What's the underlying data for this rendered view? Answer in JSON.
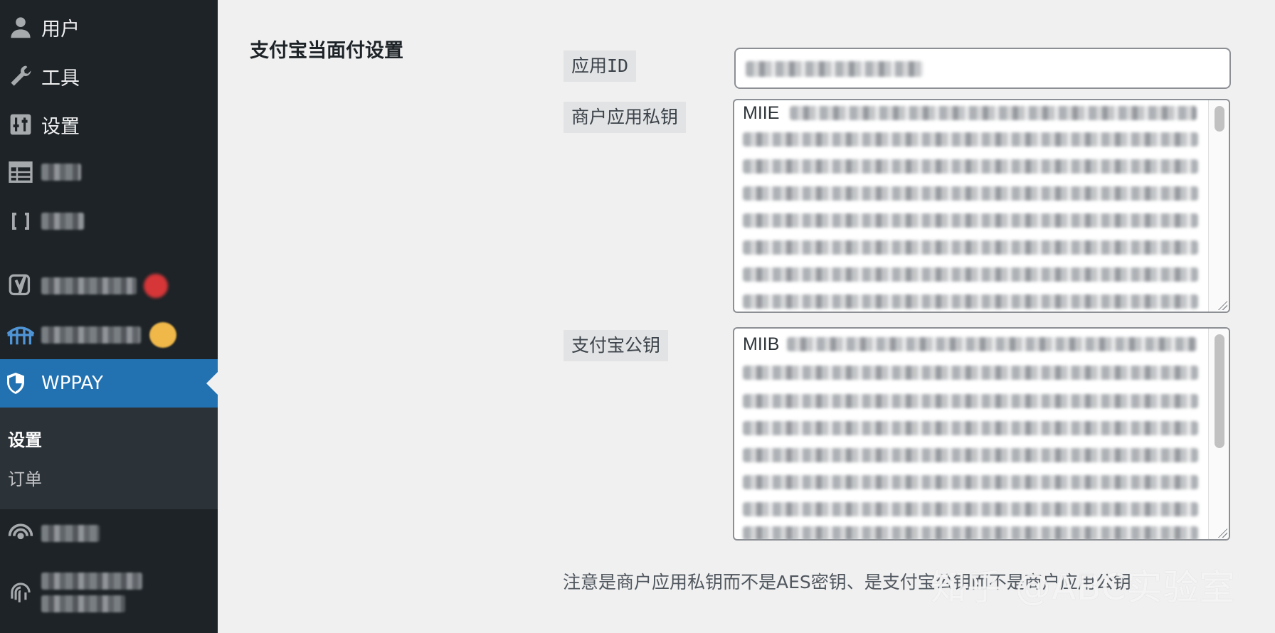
{
  "sidebar": {
    "items": [
      {
        "label": "用户",
        "icon": "user-icon"
      },
      {
        "label": "工具",
        "icon": "wrench-icon"
      },
      {
        "label": "设置",
        "icon": "settings-sliders-icon"
      },
      {
        "label": "",
        "icon": "table-icon"
      },
      {
        "label": "",
        "icon": "brackets-icon"
      },
      {
        "label": "",
        "icon": "yoast-icon"
      },
      {
        "label": "",
        "icon": "bridge-icon"
      }
    ],
    "active": {
      "label": "WPPAY",
      "icon": "shield-icon"
    },
    "submenu": [
      {
        "label": "设置",
        "current": true
      },
      {
        "label": "订单",
        "current": false
      }
    ],
    "bottom_items": [
      {
        "label": "",
        "icon": "broadcast-icon"
      },
      {
        "label": "",
        "icon": "fingerprint-icon"
      }
    ]
  },
  "main": {
    "section_title": "支付宝当面付设置",
    "fields": {
      "app_id": {
        "label": "应用ID",
        "value": ""
      },
      "private_key": {
        "label": "商户应用私钥",
        "value_prefix": "MIIE"
      },
      "public_key": {
        "label": "支付宝公钥",
        "value_prefix": "MIIB"
      }
    },
    "note": "注意是商户应用私钥而不是AES密钥、是支付宝公钥而不是商户应用公钥"
  },
  "watermark": "知乎 @ABC实验室",
  "colors": {
    "sidebar_bg": "#1d2327",
    "sidebar_active": "#2271b1",
    "submenu_bg": "#2c3338",
    "page_bg": "#f0f0f1",
    "label_bg": "#e2e3e4"
  }
}
